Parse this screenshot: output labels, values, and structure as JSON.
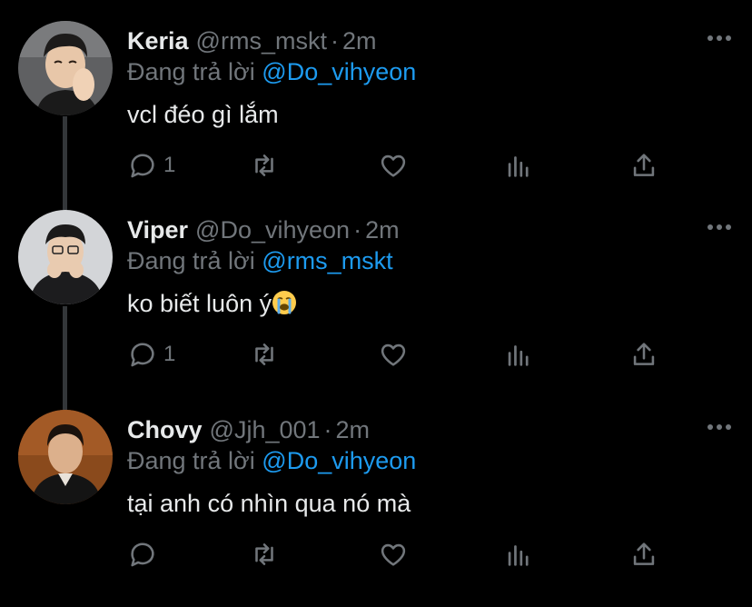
{
  "tweets": [
    {
      "name": "Keria",
      "handle": "@rms_mskt",
      "dot": "·",
      "time": "2m",
      "replying_prefix": "Đang trả lời",
      "replying_to": "@Do_vihyeon",
      "text": "vcl đéo gì lắm",
      "reply_count": "1",
      "avatar_bg": "#6b6b6b"
    },
    {
      "name": "Viper",
      "handle": "@Do_vihyeon",
      "dot": "·",
      "time": "2m",
      "replying_prefix": "Đang trả lời",
      "replying_to": "@rms_mskt",
      "text": "ko biết luôn ý",
      "emoji": "loudly-crying-face",
      "reply_count": "1",
      "avatar_bg": "#cfd2d6"
    },
    {
      "name": "Chovy",
      "handle": "@Jjh_001",
      "dot": "·",
      "time": "2m",
      "replying_prefix": "Đang trả lời",
      "replying_to": "@Do_vihyeon",
      "text": "tại anh có nhìn qua nó mà",
      "reply_count": "",
      "avatar_bg": "#8a4a1c"
    }
  ],
  "colors": {
    "background": "#000000",
    "text": "#e7e9ea",
    "muted": "#71767b",
    "link": "#1d9bf0",
    "thread_line": "#333639"
  },
  "icons": [
    "reply-icon",
    "retweet-icon",
    "like-icon",
    "analytics-icon",
    "share-icon",
    "more-icon"
  ]
}
